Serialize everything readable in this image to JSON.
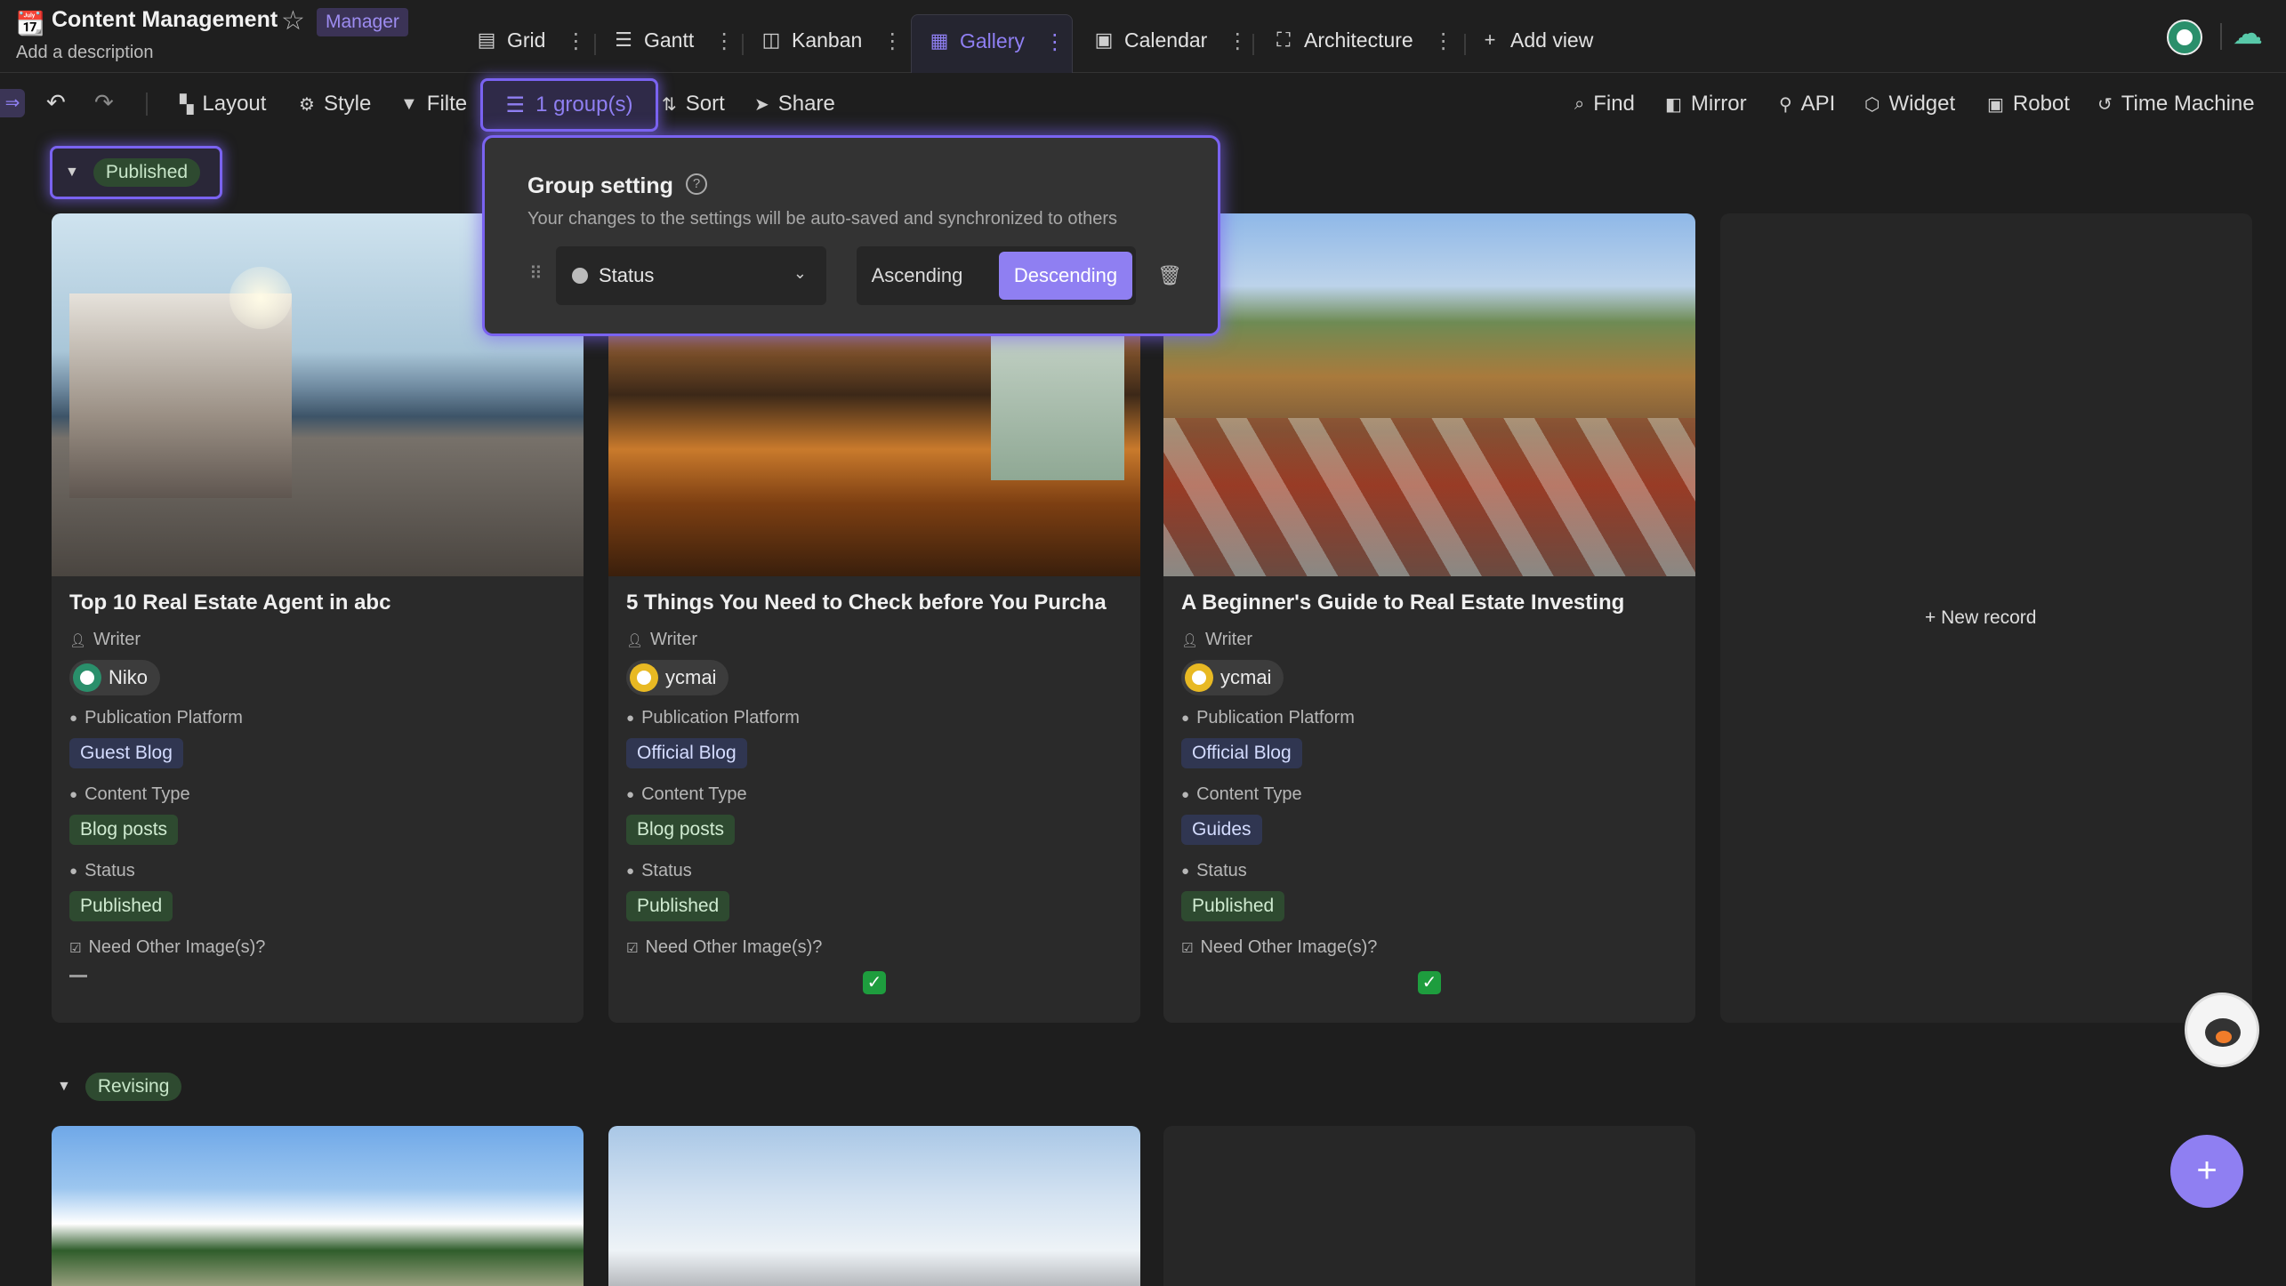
{
  "app": {
    "icon": "calendar-icon",
    "title": "Content Management",
    "role": "Manager",
    "description": "Add a description"
  },
  "views": [
    {
      "label": "Grid",
      "icon": "grid-icon"
    },
    {
      "label": "Gantt",
      "icon": "gantt-icon"
    },
    {
      "label": "Kanban",
      "icon": "kanban-icon"
    },
    {
      "label": "Gallery",
      "icon": "gallery-icon",
      "active": true
    },
    {
      "label": "Calendar",
      "icon": "calendar-icon"
    },
    {
      "label": "Architecture",
      "icon": "architecture-icon"
    }
  ],
  "add_view_label": "Add view",
  "toolbar": {
    "layout": "Layout",
    "style": "Style",
    "filter": "Filte",
    "group": "1 group(s)",
    "sort": "Sort",
    "share": "Share",
    "find": "Find",
    "mirror": "Mirror",
    "api": "API",
    "widget": "Widget",
    "robot": "Robot",
    "time_machine": "Time Machine"
  },
  "group_popup": {
    "title": "Group setting",
    "description": "Your changes to the settings will be auto-saved and synchronized to others",
    "field": "Status",
    "ascending": "Ascending",
    "descending": "Descending",
    "selected_order": "Descending"
  },
  "groups": [
    {
      "status": "Published",
      "cards": [
        {
          "title": "Top 10 Real Estate Agent in abc",
          "writer_label": "Writer",
          "writer": "Niko",
          "platform_label": "Publication Platform",
          "platform": "Guest Blog",
          "content_type_label": "Content Type",
          "content_type": "Blog posts",
          "status_label": "Status",
          "status": "Published",
          "need_images_label": "Need Other Image(s)?",
          "need_images": false
        },
        {
          "title": "5 Things You Need to Check before You Purcha",
          "writer_label": "Writer",
          "writer": "ycmai",
          "platform_label": "Publication Platform",
          "platform": "Official Blog",
          "content_type_label": "Content Type",
          "content_type": "Blog posts",
          "status_label": "Status",
          "status": "Published",
          "need_images_label": "Need Other Image(s)?",
          "need_images": true
        },
        {
          "title": "A Beginner's Guide to Real Estate Investing",
          "writer_label": "Writer",
          "writer": "ycmai",
          "platform_label": "Publication Platform",
          "platform": "Official Blog",
          "content_type_label": "Content Type",
          "content_type": "Guides",
          "status_label": "Status",
          "status": "Published",
          "need_images_label": "Need Other Image(s)?",
          "need_images": true
        }
      ],
      "new_record_label": "New record"
    },
    {
      "status": "Revising",
      "cards": []
    }
  ],
  "colors": {
    "accent": "#8f7ff2",
    "background": "#1e1e1e",
    "card": "#2a2a2a",
    "status_green": "#2e4a30",
    "tag_blue": "#303651"
  }
}
